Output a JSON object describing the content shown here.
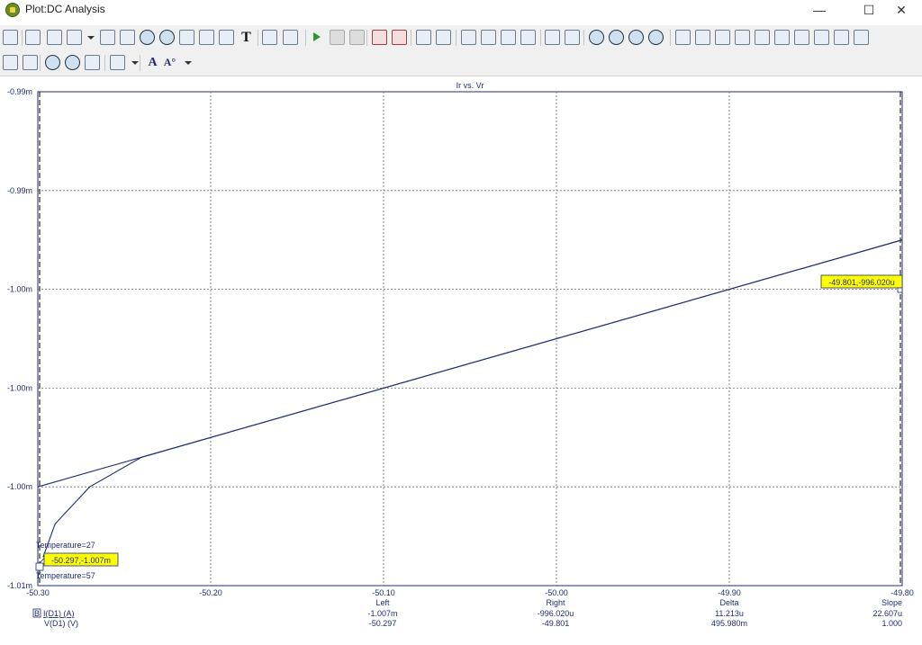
{
  "window": {
    "title": "Plot:DC Analysis",
    "minimize_glyph": "—",
    "maximize_glyph": "☐",
    "close_glyph": "✕"
  },
  "toolbar": {
    "row1_icons": [
      "print-icon",
      "pointer-icon",
      "hand-pan-icon",
      "copy-icon",
      "dropdown-arrow-icon",
      "window-icon",
      "image-icon",
      "zoom-box-icon",
      "zoom-extent-icon",
      "axis-edit-icon",
      "chart-icon",
      "legend-icon",
      "text-tool-icon",
      "properties-icon",
      "export-icon",
      "run-icon",
      "stop-icon",
      "pause-icon",
      "cursor-left-icon",
      "cursor-right-icon",
      "frame-icon",
      "grid-box-icon",
      "layout-1-icon",
      "layout-2-icon",
      "layout-3-icon",
      "layout-4-icon",
      "split-horizontal-icon",
      "split-grid-icon",
      "zoom-in-icon",
      "zoom-out-icon",
      "zoom-fit-icon",
      "zoom-reset-icon",
      "marker-peak-icon",
      "marker-valley-icon",
      "marker-max-icon",
      "marker-min-icon",
      "marker-rise-icon",
      "marker-fall-icon",
      "marker-slope-icon",
      "marker-inflect-icon",
      "marker-next-icon",
      "marker-prev-icon"
    ],
    "row2_icons": [
      "fit-vertical-icon",
      "fit-horizontal-icon",
      "zoom-in-icon",
      "zoom-out-icon",
      "hand-icon",
      "grid-dots-icon",
      "dropdown-arrow-icon",
      "font-icon",
      "font-size-icon",
      "dropdown-arrow-icon"
    ],
    "text_tool_glyph": "T",
    "font_glyph": "A",
    "font_size_glyph": "A°"
  },
  "plot": {
    "title": "Ir vs. Vr",
    "y_ticks": [
      "-0.99m",
      "-0.99m",
      "-1.00m",
      "-1.00m",
      "-1.00m",
      "-1.01m"
    ],
    "x_ticks": [
      "-50.30",
      "-50.20",
      "-50.10",
      "-50.00",
      "-49.90",
      "-49.80"
    ],
    "cursor_right_label": "-49.801,-996.020u",
    "cursor_left_label": "-50.297,-1.007m",
    "temp_27": "Temperature=27",
    "temp_57": "Temperature=57",
    "line_color": "#1f2e6e"
  },
  "chart_data": {
    "type": "line",
    "title": "Ir vs. Vr",
    "xlim": [
      -50.3,
      -49.8
    ],
    "ylim": [
      -1.01,
      -0.99
    ],
    "grid": true,
    "series": [
      {
        "name": "Temperature=27",
        "x": [
          -50.3,
          -49.8
        ],
        "y": [
          -1.006,
          -0.996
        ]
      },
      {
        "name": "Temperature=57",
        "x": [
          -50.297,
          -50.29,
          -50.27,
          -50.24,
          -50.2,
          -50.0,
          -49.8
        ],
        "y": [
          -1.00885,
          -1.0075,
          -1.006,
          -1.0048,
          -1.004,
          -1.0,
          -0.996
        ]
      }
    ]
  },
  "cursor_table": {
    "headers": [
      "Left",
      "Right",
      "Delta",
      "Slope"
    ],
    "rows": [
      {
        "marker": "B",
        "name": "I(D1) (A)",
        "values": [
          "-1.007m",
          "-996.020u",
          "11.213u",
          "22.607u"
        ]
      },
      {
        "marker": "",
        "name": "V(D1) (V)",
        "values": [
          "-50.297",
          "-49.801",
          "495.980m",
          "1.000"
        ]
      }
    ]
  }
}
